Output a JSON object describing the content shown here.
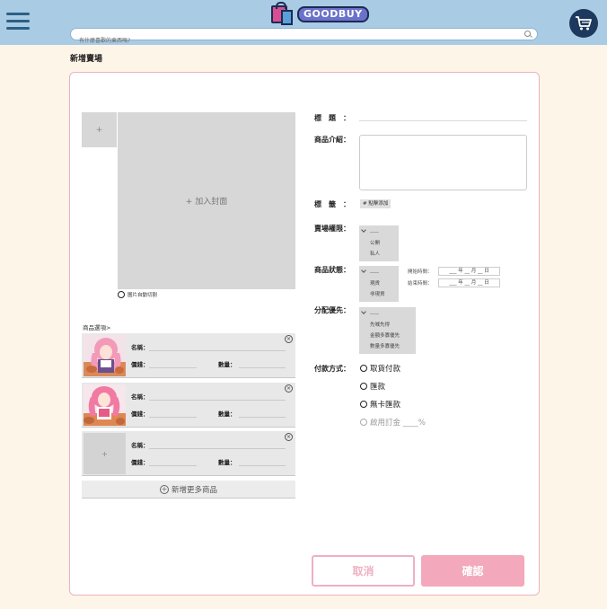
{
  "header": {
    "logo_text": "GOODBUY",
    "search_placeholder": "有什麼喜歡的東西嗎?"
  },
  "page_title": "新增賣場",
  "left": {
    "small_thumb_plus": "+",
    "cover_label": "+ 加入封面",
    "auto_crop_label": "圖片自動切割",
    "options_header": "商品選項>",
    "products": [
      {
        "name_label": "名稱：",
        "price_label": "價錢：",
        "qty_label": "數量：",
        "close": "×",
        "image": "anime-figure-1"
      },
      {
        "name_label": "名稱：",
        "price_label": "價錢：",
        "qty_label": "數量：",
        "close": "×",
        "image": "anime-figure-2"
      },
      {
        "name_label": "名稱：",
        "price_label": "價錢：",
        "qty_label": "數量：",
        "close": "×",
        "image": "empty",
        "plus": "+"
      }
    ],
    "add_more_icon": "+",
    "add_more_label": "新增更多商品"
  },
  "form": {
    "title_label": "標　題　：",
    "desc_label": "商品介紹：",
    "tag_label": "標　籤　：",
    "tag_button": "# 點擊添加",
    "perm_label": "賣場權限：",
    "perm_options": [
      "-----",
      "公開",
      "私人"
    ],
    "status_label": "商品狀態：",
    "status_options": [
      "-----",
      "現貨",
      "非現貨"
    ],
    "start_label": "開始時間：",
    "end_label": "結束時間：",
    "date_placeholder": "___ 年 __ 月 __ 日",
    "alloc_label": "分配優先：",
    "alloc_options": [
      "-----",
      "先喊先得",
      "金額多寡優先",
      "數量多寡優先"
    ],
    "pay_label": "付款方式：",
    "pay_options": [
      "取貨付款",
      "匯款",
      "無卡匯款"
    ],
    "deposit_label": "啟用訂金 ____%"
  },
  "buttons": {
    "cancel": "取消",
    "confirm": "確認"
  },
  "colors": {
    "header_bg": "#a9cbe4",
    "page_bg": "#fdf5e7",
    "accent_pink": "#efb0c2",
    "confirm_bg": "#f3a8bb",
    "cart_bg": "#1d3a5e"
  }
}
